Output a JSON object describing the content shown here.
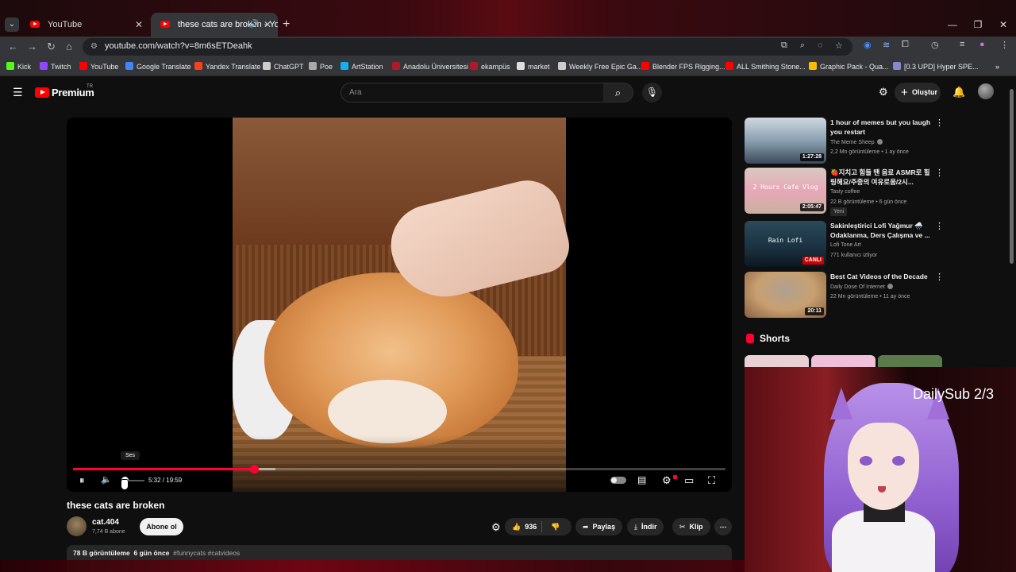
{
  "browser": {
    "tabs": [
      {
        "label": "YouTube"
      },
      {
        "label": "these cats are broken - YouTube"
      }
    ],
    "url": "youtube.com/watch?v=8m6sETDeahk",
    "bookmarks": [
      {
        "label": "Kick",
        "color": "#53fc18"
      },
      {
        "label": "Twitch",
        "color": "#9146ff"
      },
      {
        "label": "YouTube",
        "color": "#ff0000"
      },
      {
        "label": "Google Translate",
        "color": "#4285f4"
      },
      {
        "label": "Yandex Translate",
        "color": "#fc3f1d"
      },
      {
        "label": "ChatGPT",
        "color": "#cccccc"
      },
      {
        "label": "Poe",
        "color": "#aaaaaa"
      },
      {
        "label": "ArtStation",
        "color": "#13aff0"
      },
      {
        "label": "Anadolu Üniversitesi",
        "color": "#b0182c"
      },
      {
        "label": "ekampüs",
        "color": "#b0182c"
      },
      {
        "label": "market",
        "color": "#dddddd"
      },
      {
        "label": "Weekly Free Epic Ga...",
        "color": "#cccccc"
      },
      {
        "label": "Blender FPS Rigging...",
        "color": "#ff0000"
      },
      {
        "label": "ALL Smithing Stone...",
        "color": "#ff0000"
      },
      {
        "label": "Graphic Pack - Qua...",
        "color": "#fbbc05"
      },
      {
        "label": "[0.3 UPD] Hyper SPE...",
        "color": "#8888cc"
      }
    ]
  },
  "header": {
    "logo_text": "Premium",
    "region": "TR",
    "search_placeholder": "Ara",
    "create_label": "Oluştur"
  },
  "player": {
    "tooltip": "Ses",
    "time": "5:32 / 19:59",
    "progress": 0.277,
    "buffered": 0.31,
    "volume": 0.1
  },
  "video": {
    "title": "these cats are broken",
    "channel": "cat.404",
    "subscribers": "7,74 B abone",
    "subscribe_label": "Abone ol",
    "likes": "936",
    "share_label": "Paylaş",
    "download_label": "İndir",
    "clip_label": "Klip",
    "views": "78 B görüntüleme",
    "age": "6 gün önce",
    "tags": "#funnycats #catvideos"
  },
  "recommendations": [
    {
      "title": "1 hour of memes but you laugh you restart",
      "channel": "The Meme Sheep",
      "verified": true,
      "meta": "2,2 Mn görüntüleme • 1 ay önce",
      "duration": "1:27:28"
    },
    {
      "title": "🍓지치고 힘들 땐 음료 ASMR로 힐링해요/주중의 여유로움/2시...",
      "channel": "Tasty coffee",
      "verified": false,
      "meta": "22 B görüntüleme • 6 gün önce",
      "duration": "2:05:47",
      "badge": "Yeni",
      "thumb_text": "2 Hours Cafe Vlog"
    },
    {
      "title": "Sakinleştirici Lofi Yağmur 🌧️ Odaklanma, Ders Çalışma ve ...",
      "channel": "Lofi Tone Art",
      "verified": false,
      "meta": "771 kullanıcı izliyor",
      "live": "CANLI",
      "thumb_text": "Rain Lofi"
    },
    {
      "title": "Best Cat Videos of the Decade",
      "channel": "Daily Dose Of Internet",
      "verified": true,
      "meta": "22 Mn görüntüleme • 11 ay önce",
      "duration": "20:11"
    }
  ],
  "shorts_title": "Shorts",
  "overlay": {
    "text": "DailySub 2/3"
  }
}
